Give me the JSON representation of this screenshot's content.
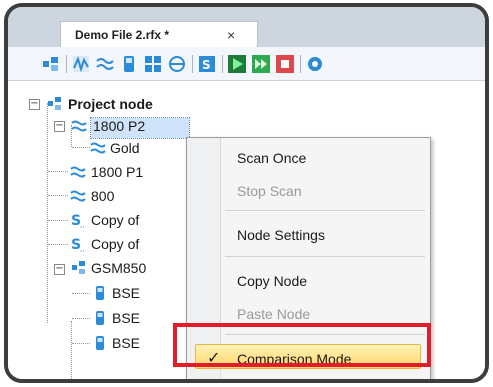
{
  "tab": {
    "title": "Demo File 2.rfx *",
    "close": "×"
  },
  "toolbar": {
    "icons": [
      "node-icon",
      "waveform-icon",
      "wave-icon",
      "device-icon",
      "grid-icon",
      "radio-icon",
      "scan-settings-icon",
      "play-icon",
      "step-icon",
      "stop-icon",
      "settings-icon"
    ]
  },
  "tree": {
    "root": "Project node",
    "n1": "1800 P2",
    "n1_child": "Gold",
    "n2": "1800 P1",
    "n3": "800",
    "n4": "Copy of",
    "n5": "Copy of",
    "n6": "GSM850",
    "n6_child1": "BSE",
    "n6_child2": "BSE",
    "n6_child3": "BSE",
    "expand_minus": "−"
  },
  "context_menu": {
    "scan_once": "Scan Once",
    "stop_scan": "Stop Scan",
    "node_settings": "Node Settings",
    "copy_node": "Copy Node",
    "paste_node": "Paste Node",
    "comparison_mode": "Comparison Mode",
    "check_glyph": "✓"
  },
  "colors": {
    "highlight_box": "#e21d2b",
    "accent_blue": "#2a8bd8",
    "play_green": "#2fa84f",
    "stop_red": "#e0474c"
  }
}
